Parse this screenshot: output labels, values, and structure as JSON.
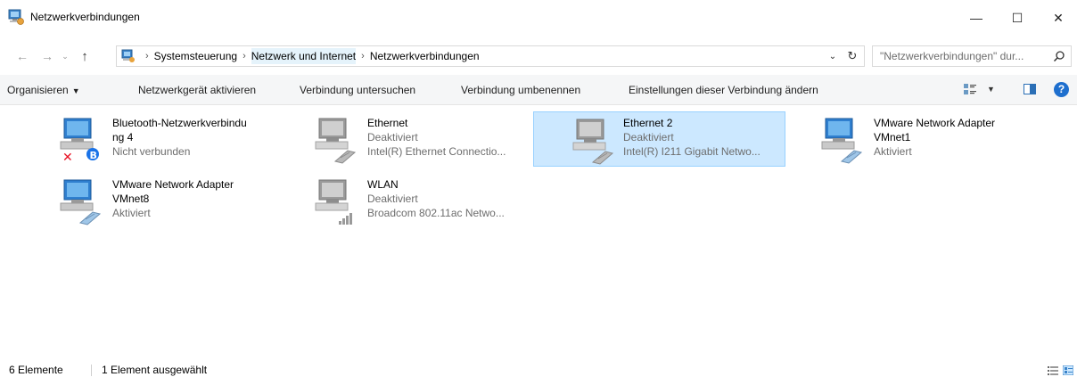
{
  "window": {
    "title": "Netzwerkverbindungen",
    "minimize_glyph": "—",
    "maximize_glyph": "☐",
    "close_glyph": "✕"
  },
  "nav": {
    "back_glyph": "←",
    "forward_glyph": "→",
    "recent_glyph": "⌄",
    "up_glyph": "↑"
  },
  "breadcrumb": {
    "items": [
      "Systemsteuerung",
      "Netzwerk und Internet",
      "Netzwerkverbindungen"
    ],
    "separator": "›",
    "dropdown_glyph": "⌄",
    "refresh_glyph": "↻"
  },
  "search": {
    "placeholder": "\"Netzwerkverbindungen\" dur..."
  },
  "toolbar": {
    "organize": "Organisieren",
    "organize_caret": "▼",
    "activate": "Netzwerkgerät aktivieren",
    "diagnose": "Verbindung untersuchen",
    "rename": "Verbindung umbenennen",
    "settings": "Einstellungen dieser Verbindung ändern",
    "view_caret": "▼",
    "help": "?"
  },
  "connections": [
    {
      "name_line1": "Bluetooth-Netzwerkverbindu",
      "name_line2": "ng 4",
      "status": "Nicht verbunden",
      "device": "",
      "icon": "bluetooth-network-icon",
      "selected": false
    },
    {
      "name_line1": "Ethernet",
      "name_line2": "",
      "status": "Deaktiviert",
      "device": "Intel(R) Ethernet Connectio...",
      "icon": "ethernet-adapter-icon",
      "selected": false
    },
    {
      "name_line1": "Ethernet 2",
      "name_line2": "",
      "status": "Deaktiviert",
      "device": "Intel(R) I211 Gigabit Netwo...",
      "icon": "ethernet-adapter-icon",
      "selected": true
    },
    {
      "name_line1": "VMware Network Adapter",
      "name_line2": "VMnet1",
      "status": "Aktiviert",
      "device": "",
      "icon": "ethernet-adapter-icon",
      "selected": false
    },
    {
      "name_line1": "VMware Network Adapter",
      "name_line2": "VMnet8",
      "status": "Aktiviert",
      "device": "",
      "icon": "ethernet-adapter-icon",
      "selected": false
    },
    {
      "name_line1": "WLAN",
      "name_line2": "",
      "status": "Deaktiviert",
      "device": "Broadcom 802.11ac Netwo...",
      "icon": "wlan-adapter-icon",
      "selected": false
    }
  ],
  "status": {
    "count": "6 Elemente",
    "selection": "1 Element ausgewählt"
  },
  "colors": {
    "selection_bg": "#cce8ff",
    "selection_border": "#99d1ff",
    "toolbar_bg": "#f5f6f7",
    "accent": "#1e6fce"
  }
}
